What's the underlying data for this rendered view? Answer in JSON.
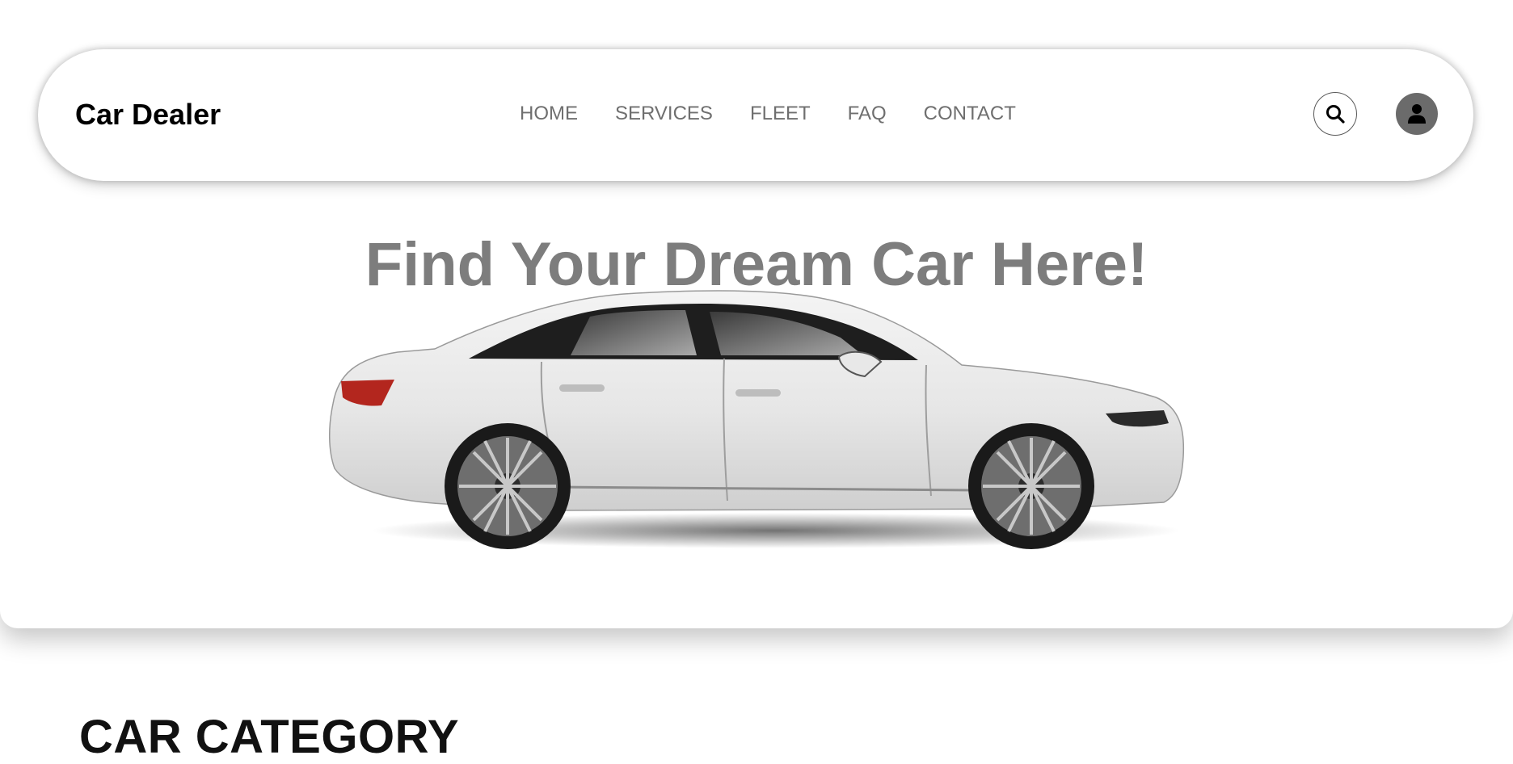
{
  "navbar": {
    "brand": "Car Dealer",
    "links": [
      {
        "label": "HOME"
      },
      {
        "label": "SERVICES"
      },
      {
        "label": "FLEET"
      },
      {
        "label": "FAQ"
      },
      {
        "label": "CONTACT"
      }
    ],
    "search_icon": "search-icon",
    "user_icon": "user-icon"
  },
  "hero": {
    "title": "Find Your Dream Car Here!",
    "image": "white-sedan-car"
  },
  "section": {
    "title": "CAR CATEGORY"
  },
  "colors": {
    "nav_text": "#6f6f6f",
    "hero_title": "#7d7d7d",
    "avatar_bg": "#6b6b6b"
  }
}
